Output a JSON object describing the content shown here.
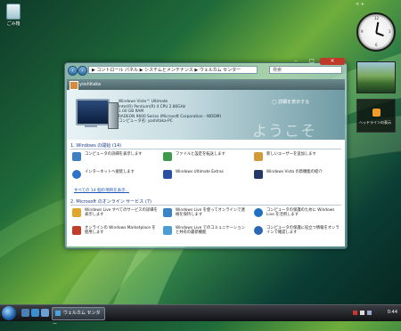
{
  "desktop": {
    "recycle_label": "ごみ箱"
  },
  "sidebar": {
    "tools_label": "< +",
    "clock_numbers": [
      "12",
      "3",
      "6",
      "9"
    ],
    "feed_label": "ヘッドラインの表示",
    "rss_color": "#f19a2a"
  },
  "window": {
    "address": "▶ コントロール パネル ▶ システムとメンテナンス ▶ ウェルカム センター",
    "search_placeholder": "検索",
    "user_name": "yoshitaka",
    "specs": [
      "Windows Vista™ Ultimate",
      "Intel(R) Pentium(R) 4 CPU 2.80GHz",
      "1.00 GB RAM",
      "RADEON 9600 Series (Microsoft Corporation - WDDM)",
      "コンピュータ名: yoshitaka-PC"
    ],
    "details_link": "◯ 詳細を表示する",
    "welcome_text": "ようこそ",
    "section1": {
      "title": "1. Windows の開始 (14)",
      "items": [
        {
          "label": "コンピュータの詳細を表示します",
          "color": "#3f7fc7"
        },
        {
          "label": "ファイルと設定を転送します",
          "color": "#3c9a4a"
        },
        {
          "label": "新しいユーザーを追加します",
          "color": "#d49a3a"
        },
        {
          "label": "インターネットへ接続します",
          "color": "#2f73c9"
        },
        {
          "label": "Windows Ultimate Extras",
          "color": "#2b4fa5"
        },
        {
          "label": "Windows Vista の新機能の紹介",
          "color": "#223a6b"
        }
      ],
      "more_link": "すべての 14 個の項目を表示..."
    },
    "section2": {
      "title": "2. Microsoft のオンライン サービス (7)",
      "items": [
        {
          "label": "Windows Live すべてのサービスの詳細を表示します",
          "color": "#e0a52b"
        },
        {
          "label": "Windows Live を使ってオンラインで連絡を保持します",
          "color": "#3b83c9"
        },
        {
          "label": "コンピュータの保護のために Windows Live を活用します",
          "color": "#1f6fc2"
        },
        {
          "label": "オンラインの Windows Marketplace を使用します",
          "color": "#c13c2a"
        },
        {
          "label": "Windows Live でのコミュニケーションと共有の最新機能",
          "color": "#4a9ed6"
        },
        {
          "label": "コンピュータの保護に役立つ情報をオンラインで確認します",
          "color": "#2c66b8"
        }
      ]
    }
  },
  "taskbar": {
    "task_label": "ウェルカム センター",
    "clock": "0:44"
  }
}
